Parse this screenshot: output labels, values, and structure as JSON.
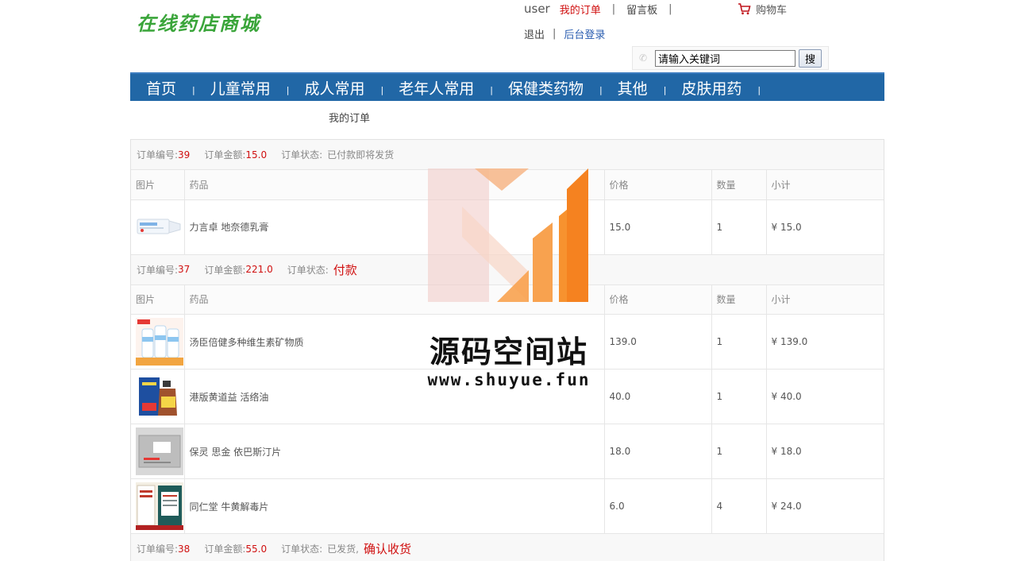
{
  "site": {
    "logo": "在线药店商城"
  },
  "header": {
    "username": "user",
    "my_orders": "我的订单",
    "message_board": "留言板",
    "logout": "退出",
    "admin_login": "后台登录",
    "separator": "|",
    "cart": "购物车"
  },
  "search": {
    "value": "请输入关键词",
    "button": "搜"
  },
  "nav": {
    "items": [
      {
        "label": "首页"
      },
      {
        "label": "儿童常用"
      },
      {
        "label": "成人常用"
      },
      {
        "label": "老年人常用"
      },
      {
        "label": "保健类药物"
      },
      {
        "label": "其他"
      },
      {
        "label": "皮肤用药"
      }
    ],
    "separator": "|"
  },
  "breadcrumb": "我的订单",
  "labels": {
    "order_no": "订单编号:",
    "order_amount": "订单金额:",
    "order_status": "订单状态:"
  },
  "table_headers": {
    "pic": "图片",
    "name": "药品",
    "price": "价格",
    "qty": "数量",
    "subtotal": "小计"
  },
  "orders": [
    {
      "id": "39",
      "amount": "15.0",
      "status": "已付款即将发货",
      "action": "",
      "items": [
        {
          "name": "力言卓 地奈德乳膏",
          "price": "15.0",
          "qty": "1",
          "subtotal": "¥ 15.0",
          "thumb": "cream-tube"
        }
      ]
    },
    {
      "id": "37",
      "amount": "221.0",
      "status": "",
      "action": "付款",
      "items": [
        {
          "name": "汤臣倍健多种维生素矿物质",
          "price": "139.0",
          "qty": "1",
          "subtotal": "¥ 139.0",
          "thumb": "vitamin-bottles"
        },
        {
          "name": "港版黄道益 活络油",
          "price": "40.0",
          "qty": "1",
          "subtotal": "¥ 40.0",
          "thumb": "oil-bottle"
        },
        {
          "name": "保灵 思金 依巴斯汀片",
          "price": "18.0",
          "qty": "1",
          "subtotal": "¥ 18.0",
          "thumb": "tablet-pack"
        },
        {
          "name": "同仁堂 牛黄解毒片",
          "price": "6.0",
          "qty": "4",
          "subtotal": "¥ 24.0",
          "thumb": "medicine-box"
        }
      ]
    },
    {
      "id": "38",
      "amount": "55.0",
      "status": "已发货,",
      "action": "确认收货",
      "items": []
    }
  ],
  "watermark": {
    "title": "源码空间站",
    "url": "www.shuyue.fun"
  },
  "colors": {
    "nav_bg": "#2167a6",
    "accent_red": "#d01010",
    "logo_green": "#3aa53a"
  }
}
